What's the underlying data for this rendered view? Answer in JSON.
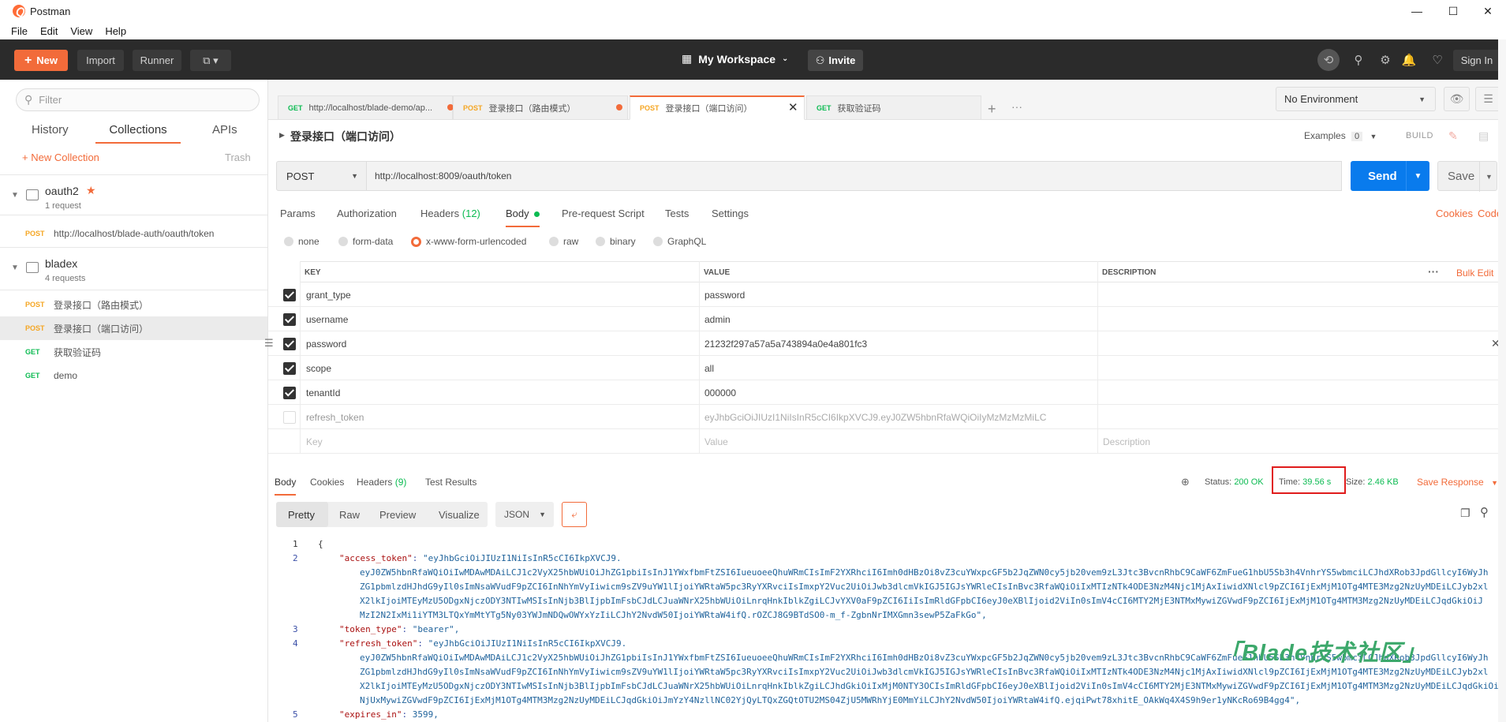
{
  "window": {
    "title": "Postman",
    "controls": [
      "—",
      "☐",
      "✕"
    ]
  },
  "menu": [
    "File",
    "Edit",
    "View",
    "Help"
  ],
  "header": {
    "new_label": "New",
    "import_label": "Import",
    "runner_label": "Runner",
    "workspace": "My Workspace",
    "invite": "Invite",
    "signin": "Sign In"
  },
  "sidebar": {
    "filter_placeholder": "Filter",
    "tabs": [
      "History",
      "Collections",
      "APIs"
    ],
    "new_collection": "+ New Collection",
    "trash": "Trash",
    "collections": [
      {
        "name": "oauth2",
        "count": "1 request",
        "star": "★",
        "requests": [
          {
            "method": "POST",
            "name": "http://localhost/blade-auth/oauth/token"
          }
        ]
      },
      {
        "name": "bladex",
        "count": "4 requests",
        "requests": [
          {
            "method": "POST",
            "name": "登录接口（路由模式）"
          },
          {
            "method": "POST",
            "name": "登录接口（端口访问）"
          },
          {
            "method": "GET",
            "name": "获取验证码"
          },
          {
            "method": "GET",
            "name": "demo"
          }
        ]
      }
    ]
  },
  "tabs": [
    {
      "method": "GET",
      "label": "http://localhost/blade-demo/ap..."
    },
    {
      "method": "POST",
      "label": "登录接口（路由模式）"
    },
    {
      "method": "POST",
      "label": "登录接口（端口访问）"
    },
    {
      "method": "GET",
      "label": "获取验证码"
    }
  ],
  "environment": "No Environment",
  "request": {
    "title": "登录接口（端口访问）",
    "examples_label": "Examples",
    "examples_count": "0",
    "build": "BUILD",
    "method": "POST",
    "url": "http://localhost:8009/oauth/token",
    "send": "Send",
    "save": "Save",
    "subtabs": [
      "Params",
      "Authorization",
      "Headers",
      "Body",
      "Pre-request Script",
      "Tests",
      "Settings"
    ],
    "headers_count": "(12)",
    "cookies": "Cookies",
    "code": "Code",
    "body_types": [
      "none",
      "form-data",
      "x-www-form-urlencoded",
      "raw",
      "binary",
      "GraphQL"
    ],
    "table_headers": {
      "key": "KEY",
      "value": "VALUE",
      "description": "DESCRIPTION",
      "bulk_edit": "Bulk Edit"
    },
    "params": [
      {
        "key": "grant_type",
        "value": "password",
        "checked": true
      },
      {
        "key": "username",
        "value": "admin",
        "checked": true
      },
      {
        "key": "password",
        "value": "21232f297a57a5a743894a0e4a801fc3",
        "checked": true
      },
      {
        "key": "scope",
        "value": "all",
        "checked": true
      },
      {
        "key": "tenantId",
        "value": "000000",
        "checked": true
      },
      {
        "key": "refresh_token",
        "value": "eyJhbGciOiJIUzI1NiIsInR5cCI6IkpXVCJ9.eyJ0ZW5hbnRfaWQiOiIyMzMzMzMiLC",
        "checked": false
      }
    ],
    "placeholder_row": {
      "key": "Key",
      "value": "Value",
      "description": "Description"
    }
  },
  "response": {
    "tabs": [
      "Body",
      "Cookies",
      "Headers",
      "Test Results"
    ],
    "headers_count": "(9)",
    "status_label": "Status:",
    "status_value": "200 OK",
    "time_label": "Time:",
    "time_value": "39.56 s",
    "size_label": "Size:",
    "size_value": "2.46 KB",
    "save_response": "Save Response",
    "views": [
      "Pretty",
      "Raw",
      "Preview",
      "Visualize"
    ],
    "format": "JSON",
    "lines": [
      {
        "n": "1",
        "text": "{"
      },
      {
        "n": "2",
        "key": "\"access_token\"",
        "val": "\"eyJhbGciOiJIUzI1NiIsInR5cCI6IkpXVCJ9."
      },
      {
        "n": "",
        "cont": "eyJ0ZW5hbnRfaWQiOiIwMDAwMDAiLCJ1c2VyX25hbWUiOiJhZG1pbiIsInJ1YWxfbmFtZSI6IueuoeeQhuWRmCIsImF2YXRhciI6Imh0dHBzOi8vZ3cuYWxpcGF5b2JqZWN0cy5jb20vem9zL3Jtc3BvcnRhbC9CaWF6ZmFueG1hbU5Sb3h4VnhrYS5wbmciLCJhdXRob3JpdGllcyI6WyJh"
      },
      {
        "n": "",
        "cont": "ZG1pbmlzdHJhdG9yIl0sImNsaWVudF9pZCI6InNhYmVyIiwicm9sZV9uYW1lIjoiYWRtaW5pc3RyYXRvciIsImxpY2Vuc2UiOiJwb3dlcmVkIGJ5IGJsYWRleCIsInBvc3RfaWQiOiIxMTIzNTk4ODE3NzM4Njc1MjAxIiwidXNlcl9pZCI6IjExMjM1OTg4MTE3Mzg2NzUyMDEiLCJyb2xl"
      },
      {
        "n": "",
        "cont": "X2lkIjoiMTEyMzU5ODgxNjczODY3NTIwMSIsInNjb3BlIjpbImFsbCJdLCJuaWNrX25hbWUiOiLnrqHnkIblkZgiLCJvYXV0aF9pZCI6IiIsImRldGFpbCI6eyJ0eXBlIjoid2ViIn0sImV4cCI6MTY2MjE3NTMxMywiZGVwdF9pZCI6IjExMjM1OTg4MTM3Mzg2NzUyMDEiLCJqdGkiOiJ"
      },
      {
        "n": "",
        "cont": "MzI2N2IxMi1iYTM3LTQxYmMtYTg5Ny03YWJmNDQwOWYxYzIiLCJhY2NvdW50IjoiYWRtaW4ifQ.rOZCJ8G9BTdSO0-m_f-ZgbnNrIMXGmn3sewP5ZaFkGo\","
      },
      {
        "n": "3",
        "key": "\"token_type\"",
        "val": "\"bearer\","
      },
      {
        "n": "4",
        "key": "\"refresh_token\"",
        "val": "\"eyJhbGciOiJIUzI1NiIsInR5cCI6IkpXVCJ9."
      },
      {
        "n": "",
        "cont": "eyJ0ZW5hbnRfaWQiOiIwMDAwMDAiLCJ1c2VyX25hbWUiOiJhZG1pbiIsInJ1YWxfbmFtZSI6IueuoeeQhuWRmCIsImF2YXRhciI6Imh0dHBzOi8vZ3cuYWxpcGF5b2JqZWN0cy5jb20vem9zL3Jtc3BvcnRhbC9CaWF6ZmFueG1hbU5Sb3h4VnhrYS5wbmciLCJhdXRob3JpdGllcyI6WyJh"
      },
      {
        "n": "",
        "cont": "ZG1pbmlzdHJhdG9yIl0sImNsaWVudF9pZCI6InNhYmVyIiwicm9sZV9uYW1lIjoiYWRtaW5pc3RyYXRvciIsImxpY2Vuc2UiOiJwb3dlcmVkIGJ5IGJsYWRleCIsInBvc3RfaWQiOiIxMTIzNTk4ODE3NzM4Njc1MjAxIiwidXNlcl9pZCI6IjExMjM1OTg4MTE3Mzg2NzUyMDEiLCJyb2xl"
      },
      {
        "n": "",
        "cont": "X2lkIjoiMTEyMzU5ODgxNjczODY3NTIwMSIsInNjb3BlIjpbImFsbCJdLCJuaWNrX25hbWUiOiLnrqHnkIblkZgiLCJhdGkiOiIxMjM0NTY3OCIsImRldGFpbCI6eyJ0eXBlIjoid2ViIn0sImV4cCI6MTY2MjE3NTMxMywiZGVwdF9pZCI6IjExMjM1OTg4MTM3Mzg2NzUyMDEiLCJqdGkiOiJ"
      },
      {
        "n": "",
        "cont": "NjUxMywiZGVwdF9pZCI6IjExMjM1OTg4MTM3Mzg2NzUyMDEiLCJqdGkiOiJmYzY4NzllNC02YjQyLTQxZGQtOTU2MS04ZjU5MWRhYjE0MmYiLCJhY2NvdW50IjoiYWRtaW4ifQ.ejqiPwt78xhitE_OAkWq4X4S9h9er1yNKcRo69B4gg4\","
      },
      {
        "n": "5",
        "key": "\"expires_in\"",
        "val": "3599,"
      }
    ]
  },
  "watermark": "「Blade技术社区」",
  "colors": {
    "accent": "#f26b3a",
    "send": "#097bed",
    "header": "#2b2b2b",
    "ok": "#0cbb52",
    "highlight": "#e01c1c"
  }
}
